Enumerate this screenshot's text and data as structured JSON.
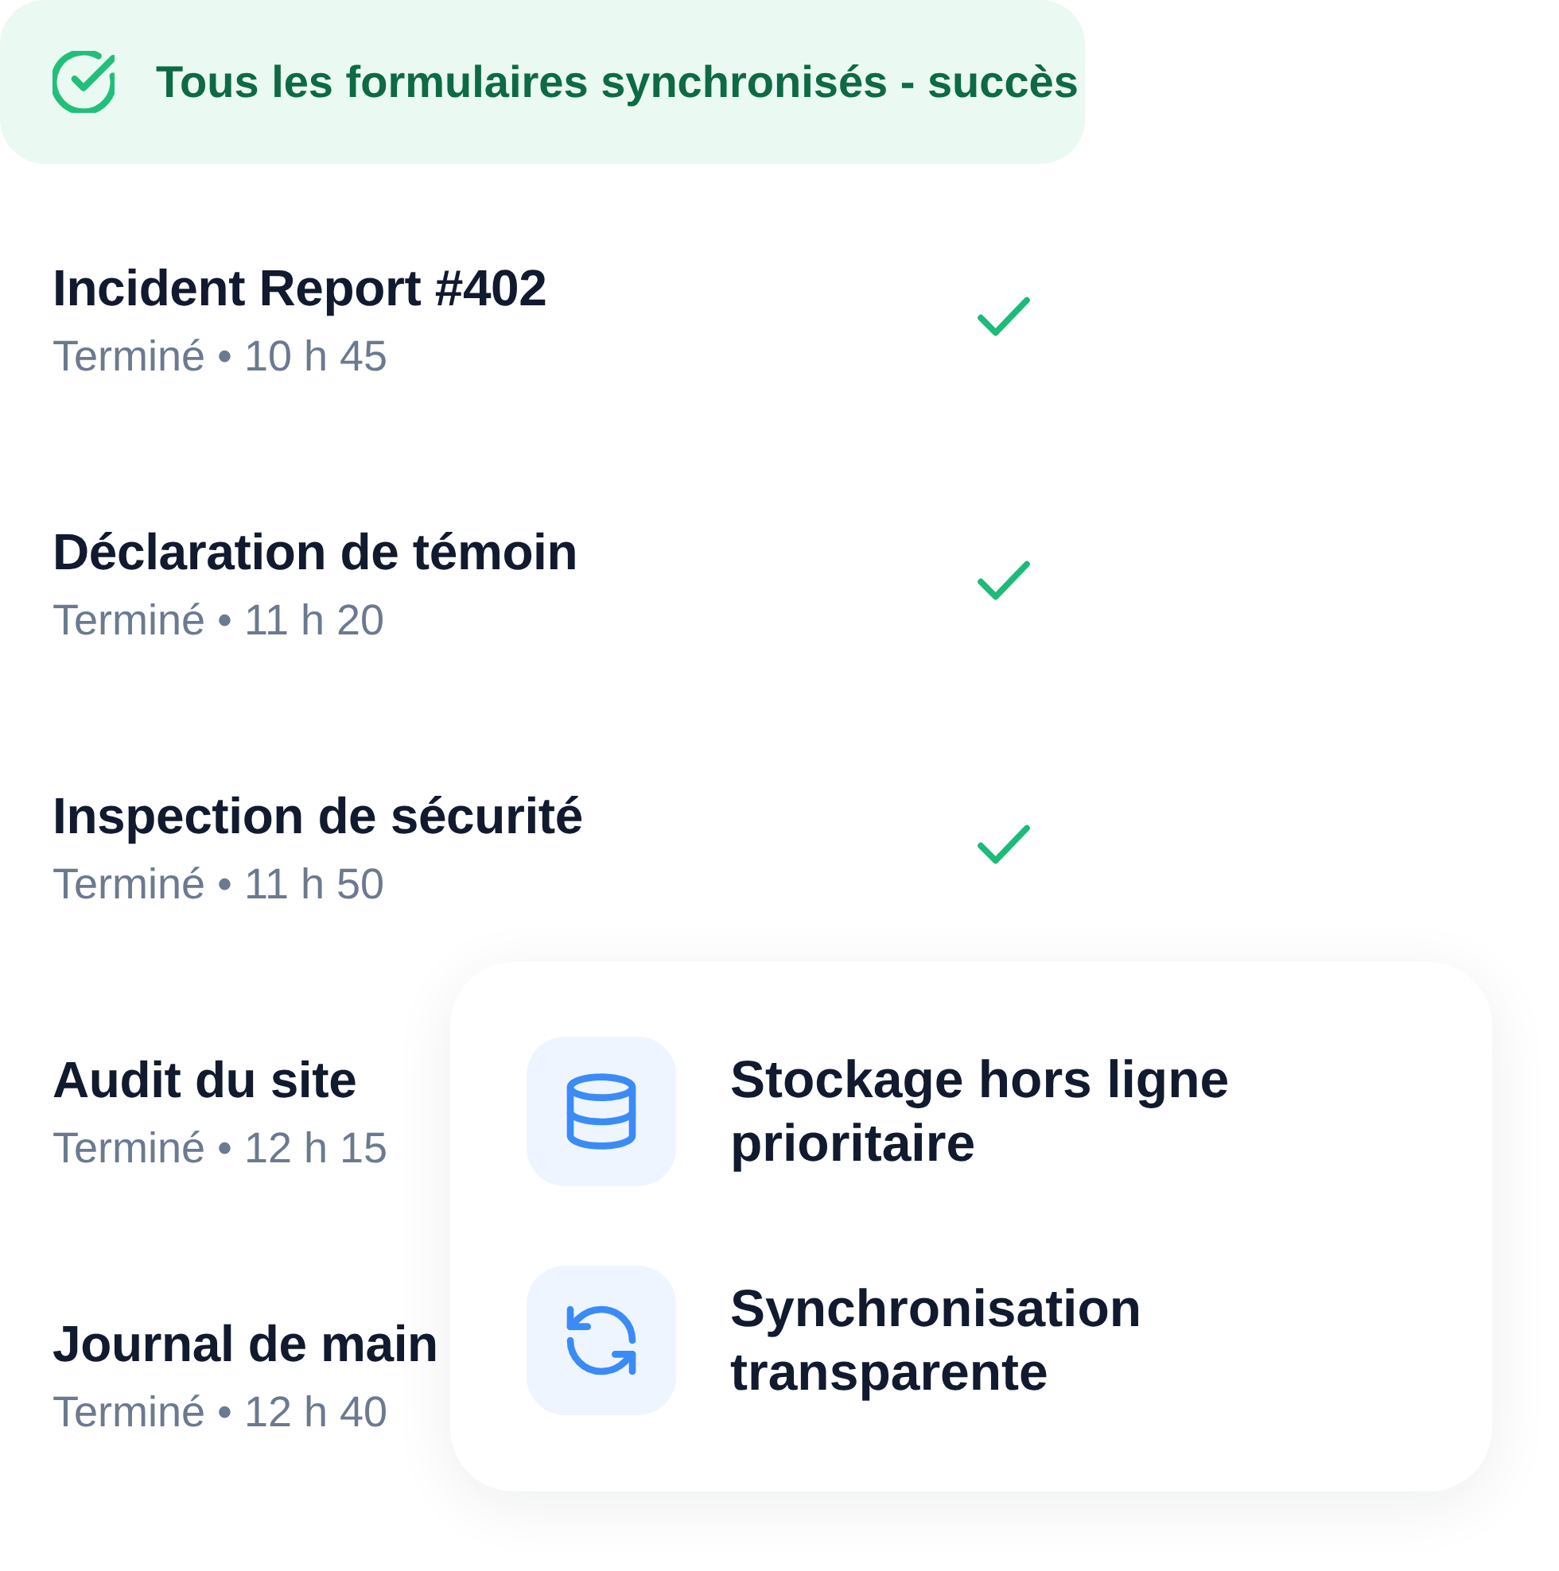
{
  "status_banner": {
    "text": "Tous les formulaires synchronisés - succès"
  },
  "forms": [
    {
      "title": "Incident Report #402",
      "status": "Terminé • 10 h 45",
      "synced": true
    },
    {
      "title": "Déclaration de témoin",
      "status": "Terminé • 11 h 20",
      "synced": true
    },
    {
      "title": "Inspection de sécurité",
      "status": "Terminé • 11 h 50",
      "synced": true
    },
    {
      "title": "Audit du site",
      "status": "Terminé • 12 h 15"
    },
    {
      "title": "Journal de main",
      "status": "Terminé • 12 h 40"
    }
  ],
  "features_card": {
    "items": [
      {
        "kind": "storage",
        "label": "Stockage hors ligne prioritaire"
      },
      {
        "kind": "sync",
        "label": "Synchronisation transparente"
      }
    ]
  }
}
